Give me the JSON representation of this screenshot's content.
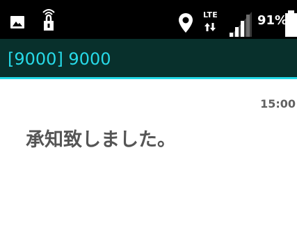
{
  "status_bar": {
    "icons": [
      "image-icon",
      "lock-icon",
      "location-icon",
      "lte-arrows-icon",
      "signal-icon",
      "battery-icon"
    ],
    "network_label": "LTE",
    "battery_label": "91%",
    "battery_level": 0.91
  },
  "header": {
    "title": "[9000] 9000"
  },
  "message": {
    "time": "15:00",
    "text": "承知致しました。"
  },
  "colors": {
    "status_bar_bg": "#000000",
    "title_bar_bg": "#08302c",
    "accent": "#22d8e6",
    "message_text": "#555555",
    "time_text": "#616161"
  }
}
